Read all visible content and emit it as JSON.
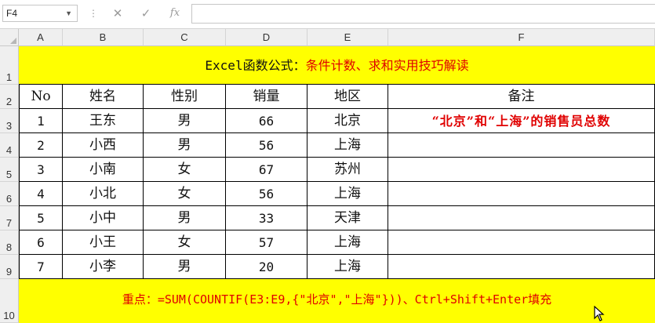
{
  "formula_bar": {
    "name_box": "F4",
    "icons": [
      "cancel-icon",
      "enter-icon",
      "insert-function-icon"
    ]
  },
  "columns": [
    "A",
    "B",
    "C",
    "D",
    "E",
    "F"
  ],
  "rows": [
    "1",
    "2",
    "3",
    "4",
    "5",
    "6",
    "7",
    "8",
    "9",
    "10"
  ],
  "title": {
    "prefix": "Excel函数公式：",
    "highlight": "条件计数、求和实用技巧解读"
  },
  "table": {
    "headers": [
      "No",
      "姓名",
      "性别",
      "销量",
      "地区",
      "备注"
    ],
    "rows": [
      [
        "1",
        "王东",
        "男",
        "66",
        "北京"
      ],
      [
        "2",
        "小西",
        "男",
        "56",
        "上海"
      ],
      [
        "3",
        "小南",
        "女",
        "67",
        "苏州"
      ],
      [
        "4",
        "小北",
        "女",
        "56",
        "上海"
      ],
      [
        "5",
        "小中",
        "男",
        "33",
        "天津"
      ],
      [
        "6",
        "小王",
        "女",
        "57",
        "上海"
      ],
      [
        "7",
        "小李",
        "男",
        "20",
        "上海"
      ]
    ],
    "note": "“北京”和“上海”的销售员总数"
  },
  "footer": "重点：=SUM(COUNTIF(E3:E9,{\"北京\",\"上海\"}))、Ctrl+Shift+Enter填充",
  "colors": {
    "banner": "#ffff00",
    "accent_red": "#e00000"
  }
}
